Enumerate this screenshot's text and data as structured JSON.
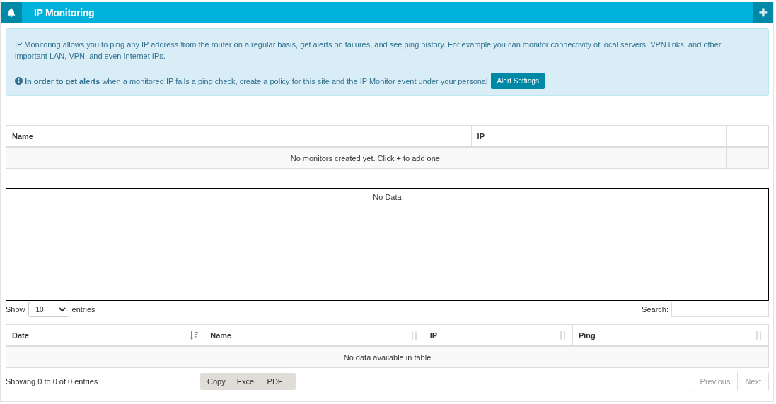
{
  "header": {
    "title": "IP Monitoring",
    "add_button": "✚"
  },
  "alert": {
    "description": "IP Monitoring allows you to ping any IP address from the router on a regular basis, get alerts on failures, and see ping history. For example you can monitor connectivity of local servers, VPN links, and other important LAN, VPN, and even Internet IPs.",
    "note": "**In order to get alerts** when a monitored IP fails a ping check, create a policy for this site and the IP Monitor event under your personal",
    "button": "Alert Settings"
  },
  "monitors_table": {
    "columns": [
      "Name",
      "IP"
    ],
    "empty_message": "No monitors created yet. Click + to add one."
  },
  "chart": {
    "message": "No Data"
  },
  "history": {
    "show_label": "Show",
    "page_size": "10",
    "entries_label": "entries",
    "search_label": "Search:",
    "columns": [
      {
        "label": "Date",
        "sorted": true
      },
      {
        "label": "Name",
        "sorted": false
      },
      {
        "label": "IP",
        "sorted": false
      },
      {
        "label": "Ping",
        "sorted": false
      }
    ],
    "empty_message": "No data available in table",
    "info": "Showing 0 to 0 of 0 entries",
    "export_buttons": [
      "Copy",
      "Excel",
      "PDF"
    ],
    "pagination": [
      {
        "label": "Previous",
        "disabled": true
      },
      {
        "label": "Next",
        "disabled": true
      }
    ]
  }
}
